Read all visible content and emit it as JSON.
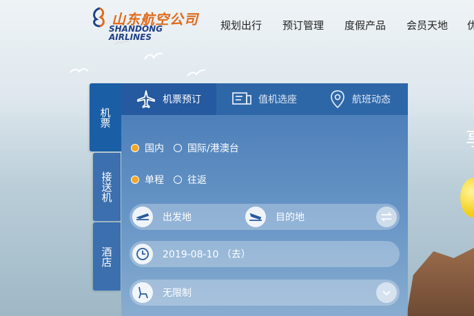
{
  "header": {
    "logo_cn": "山东航空公司",
    "logo_en_1": "SHANDONG",
    "logo_en_2": "AIRLINES",
    "nav": [
      "规划出行",
      "预订管理",
      "度假产品",
      "会员天地"
    ],
    "nav_cut": "优"
  },
  "side_tabs": [
    {
      "label": "机票",
      "active": true
    },
    {
      "label": "接送机",
      "active": false
    },
    {
      "label": "酒店",
      "active": false
    }
  ],
  "tabs": [
    {
      "label": "机票预订",
      "icon": "airplane-icon",
      "active": true
    },
    {
      "label": "值机选座",
      "icon": "seat-select-icon",
      "active": false
    },
    {
      "label": "航班动态",
      "icon": "location-pin-icon",
      "active": false
    }
  ],
  "trip_region": {
    "options": [
      "国内",
      "国际/港澳台"
    ],
    "selected": "国内"
  },
  "trip_type": {
    "options": [
      "单程",
      "往返"
    ],
    "selected": "单程"
  },
  "form": {
    "departure_placeholder": "出发地",
    "arrival_placeholder": "目的地",
    "date_value": "2019-08-10 （去）",
    "cabin_value": "无限制"
  },
  "hero_edge_char": "享",
  "colors": {
    "panel": "#2559a0",
    "accent": "#f5a623",
    "logo_orange": "#e06a1a",
    "logo_blue": "#1f3f86"
  }
}
